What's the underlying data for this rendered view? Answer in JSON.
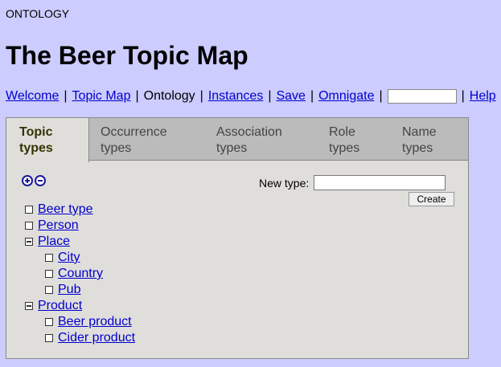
{
  "header": {
    "section_label": "ONTOLOGY",
    "title": "The Beer Topic Map"
  },
  "nav": {
    "items": [
      "Welcome",
      "Topic Map",
      "Ontology",
      "Instances",
      "Save",
      "Omnigate",
      "Help"
    ],
    "search_value": ""
  },
  "tabs": [
    {
      "line1": "Topic",
      "line2": "types"
    },
    {
      "line1": "Occurrence",
      "line2": "types"
    },
    {
      "line1": "Association",
      "line2": "types"
    },
    {
      "line1": "Role",
      "line2": "types"
    },
    {
      "line1": "Name",
      "line2": "types"
    }
  ],
  "panel": {
    "new_type_label": "New type:",
    "new_type_value": "",
    "create_label": "Create",
    "tree": [
      {
        "label": "Beer type",
        "expanded": false
      },
      {
        "label": "Person",
        "expanded": false
      },
      {
        "label": "Place",
        "expanded": true
      },
      {
        "label": "City",
        "expanded": false
      },
      {
        "label": "Country",
        "expanded": false
      },
      {
        "label": "Pub",
        "expanded": false
      },
      {
        "label": "Product",
        "expanded": true
      },
      {
        "label": "Beer product",
        "expanded": false
      },
      {
        "label": "Cider product",
        "expanded": false
      }
    ]
  },
  "colors": {
    "page_bg": "#ccccff",
    "tab_bar": "#bbbbbb",
    "panel_bg": "#e0dedb",
    "link": "#0000cc"
  }
}
